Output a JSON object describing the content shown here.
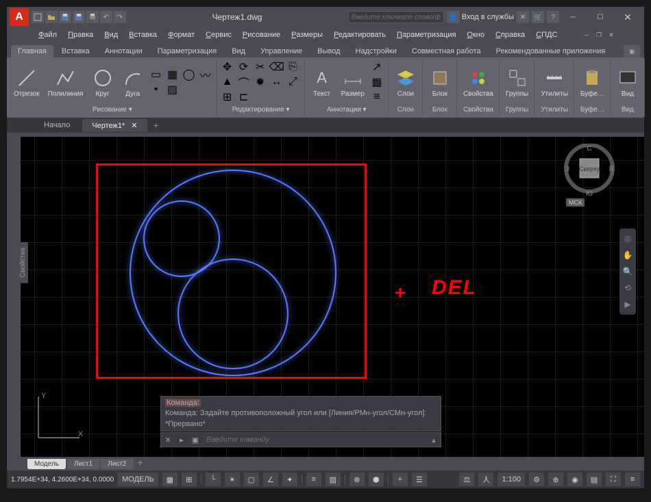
{
  "title": "Чертеж1.dwg",
  "search_placeholder": "Введите ключевое слово/фразу",
  "signin": "Вход в службы",
  "menubar": [
    "Файл",
    "Правка",
    "Вид",
    "Вставка",
    "Формат",
    "Сервис",
    "Рисование",
    "Размеры",
    "Редактировать",
    "Параметризация",
    "Окно",
    "Справка",
    "СПДС"
  ],
  "ribbon_tabs": [
    "Главная",
    "Вставка",
    "Аннотации",
    "Параметризация",
    "Вид",
    "Управление",
    "Вывод",
    "Надстройки",
    "Совместная работа",
    "Рекомендованные приложения"
  ],
  "active_ribbon_tab": "Главная",
  "panels": {
    "draw": {
      "title": "Рисование ▾",
      "line": "Отрезок",
      "polyline": "Полилиния",
      "circle": "Круг",
      "arc": "Дуга"
    },
    "modify": {
      "title": "Редактирование ▾"
    },
    "annot": {
      "title": "Аннотации ▾",
      "text": "Текст",
      "dim": "Размер"
    },
    "layers": {
      "title": "Слои",
      "btn": "Слои"
    },
    "block": {
      "title": "Блок",
      "btn": "Блок"
    },
    "props": {
      "title": "Свойства",
      "btn": "Свойства"
    },
    "groups": {
      "title": "Группы",
      "btn": "Группы"
    },
    "utils": {
      "title": "Утилиты",
      "btn": "Утилиты"
    },
    "clip": {
      "title": "Буфе…",
      "btn": "Буфе…"
    },
    "view": {
      "title": "Вид",
      "btn": "Вид"
    }
  },
  "file_tabs": {
    "start": "Начало",
    "drawing": "Чертеж1*"
  },
  "props_panel": "Свойства",
  "navcube": {
    "top": "Сверху",
    "n": "С",
    "s": "Ю",
    "w": "З",
    "e": "В",
    "wcs": "МСК"
  },
  "cmd_history": "Команда: Задайте противоположный угол или [Линия/РМн-угол/СМн-угол]: *Прервано*",
  "cmd_label": "Команда:",
  "cmd_placeholder": "Введите команду",
  "layout_tabs": [
    "Модель",
    "Лист1",
    "Лист2"
  ],
  "status": {
    "coords": "1.7954E+34, 4.2600E+34, 0.0000",
    "model": "МОДЕЛЬ",
    "scale": "1:100"
  },
  "annotation": {
    "plus": "+",
    "del": "DEL"
  },
  "ucs": {
    "x": "X",
    "y": "Y"
  }
}
